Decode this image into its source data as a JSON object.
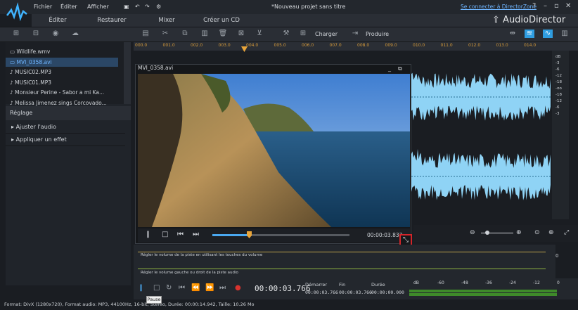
{
  "menu": {
    "file": "Fichier",
    "edit": "Éditer",
    "view": "Afficher"
  },
  "window": {
    "title": "*Nouveau projet sans titre",
    "connect": "Se connecter à DirectorZone",
    "help": "?"
  },
  "modes": [
    {
      "label": "Éditer",
      "active": true
    },
    {
      "label": "Restaurer",
      "active": false
    },
    {
      "label": "Mixer",
      "active": false
    },
    {
      "label": "Créer un CD",
      "active": false
    }
  ],
  "brand": "AudioDirector",
  "toolbar": {
    "load": "Charger",
    "produce": "Produire"
  },
  "files": [
    {
      "icon": "video-file-icon",
      "name": "Wildlife.wmv",
      "selected": false
    },
    {
      "icon": "video-file-icon",
      "name": "MVI_0358.avi",
      "selected": true
    },
    {
      "icon": "music-note-icon",
      "name": "MUSIC02.MP3",
      "selected": false
    },
    {
      "icon": "music-note-icon",
      "name": "MUSIC01.MP3",
      "selected": false
    },
    {
      "icon": "music-note-icon",
      "name": "Monsieur Perine - Sabor a mi  Ka...",
      "selected": false
    },
    {
      "icon": "music-note-icon",
      "name": "Melissa Jimenez sings Corcovado...",
      "selected": false
    }
  ],
  "settings": {
    "title": "Réglage",
    "adjust": "Ajuster l'audio",
    "effect": "Appliquer un effet"
  },
  "ruler": [
    "000.0",
    "001.0",
    "002.0",
    "003.0",
    "004.0",
    "005.0",
    "006.0",
    "007.0",
    "008.0",
    "009.0",
    "010.0",
    "011.0",
    "012.0",
    "013.0",
    "014.0"
  ],
  "db_scale": [
    "dB",
    "-3",
    "-6",
    "-12",
    "-18",
    "-oo",
    "-18",
    "-12",
    "-6",
    "-3"
  ],
  "video": {
    "title": "MVI_0358.avi",
    "time": "00:00:03.833",
    "progress": 0.27
  },
  "volume": {
    "track1": "Régler le volume de la piste en utilisant les touches du volume",
    "track2": "Régler le volume gauche ou droit de la piste audio",
    "right_val": "0"
  },
  "transport": {
    "time": "00:00:03.766",
    "start_label": "Démarrer",
    "end_label": "Fin",
    "duration_label": "Durée",
    "start": "00:00:03.766",
    "end": "00:00:03.766",
    "duration": "00:00:00.000",
    "meter_labels": [
      "dB",
      "-60",
      "-48",
      "-36",
      "-24",
      "-12",
      "0"
    ]
  },
  "tooltip": "Pause",
  "status": "Format: DivX (1280x720), Format audio: MP3, 44100Hz, 16-bit, Stéréo, Durée: 00:00:14.942, Taille: 10.26 Mo"
}
